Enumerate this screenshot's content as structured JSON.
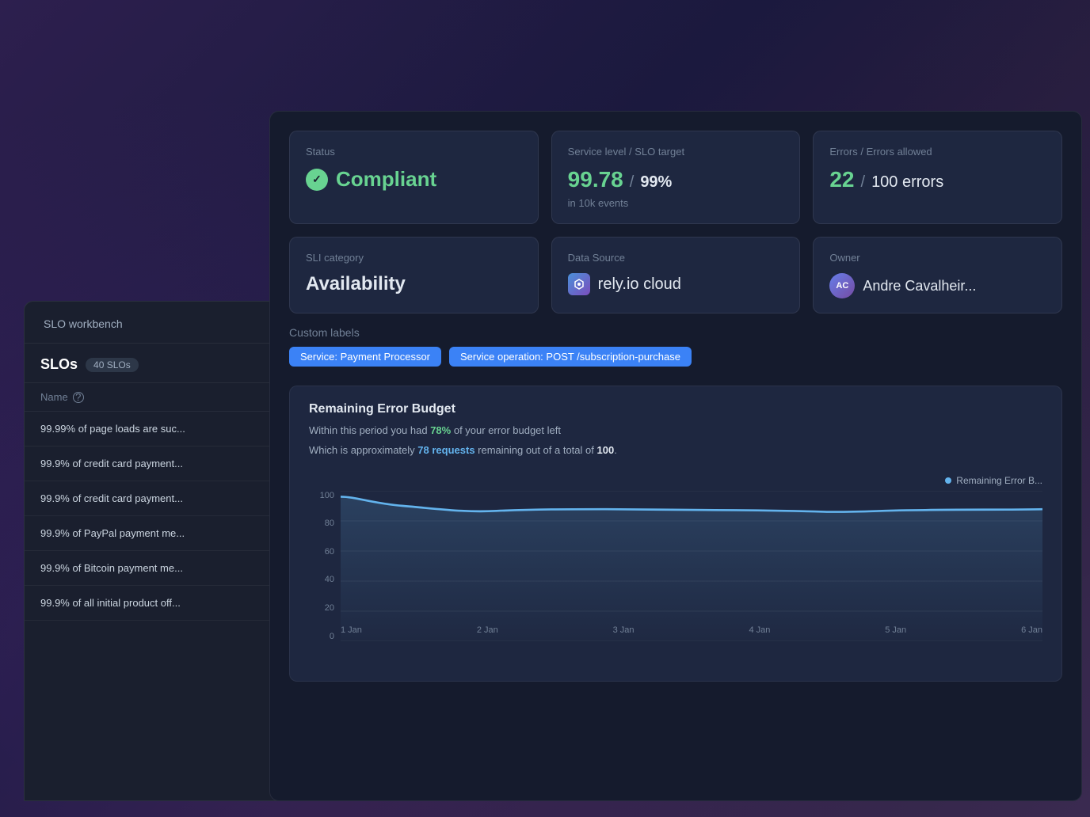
{
  "app": {
    "title": "SLO workbench"
  },
  "sidebar": {
    "title": "SLO workbench",
    "slos_header": "SLOs",
    "slos_count": "40 SLOs",
    "name_column": "Name",
    "items": [
      {
        "label": "99.99% of page loads are suc..."
      },
      {
        "label": "99.9% of credit card payment..."
      },
      {
        "label": "99.9% of credit card payment..."
      },
      {
        "label": "99.9% of PayPal payment me..."
      },
      {
        "label": "99.9% of Bitcoin payment me..."
      },
      {
        "label": "99.9% of all initial product off..."
      }
    ]
  },
  "main": {
    "cards": {
      "status": {
        "label": "Status",
        "value": "Compliant"
      },
      "service_level": {
        "label": "Service level / SLO target",
        "current": "99.78",
        "slash": "/",
        "target": "99%",
        "suffix": "in 10k events"
      },
      "errors": {
        "label": "Errors / Errors allowed",
        "current": "22",
        "slash": "/",
        "target": "100 errors"
      },
      "sli_category": {
        "label": "SLI category",
        "value": "Availability"
      },
      "data_source": {
        "label": "Data Source",
        "value": "rely.io cloud"
      },
      "owner": {
        "label": "Owner",
        "value": "Andre Cavalheir..."
      }
    },
    "custom_labels": {
      "section_label": "Custom labels",
      "tags": [
        {
          "label": "Service: Payment Processor"
        },
        {
          "label": "Service operation: POST /subscription-purchase"
        }
      ]
    },
    "error_budget": {
      "title": "Remaining Error Budget",
      "line1_prefix": "Within this period you had ",
      "line1_highlight": "78%",
      "line1_suffix": " of your error budget left",
      "line2_prefix": "Which is approximately ",
      "line2_highlight": "78 requests",
      "line2_middle": " remaining out of a total of ",
      "line2_bold": "100",
      "line2_suffix": ".",
      "legend": "Remaining Error B...",
      "chart": {
        "y_labels": [
          "100",
          "80",
          "60",
          "40",
          "20",
          "0"
        ],
        "x_labels": [
          "1 Jan",
          "2 Jan",
          "3 Jan",
          "4 Jan",
          "5 Jan",
          "6 Jan"
        ],
        "line_color": "#63b3ed",
        "grid_color": "rgba(255,255,255,0.06)"
      }
    }
  }
}
